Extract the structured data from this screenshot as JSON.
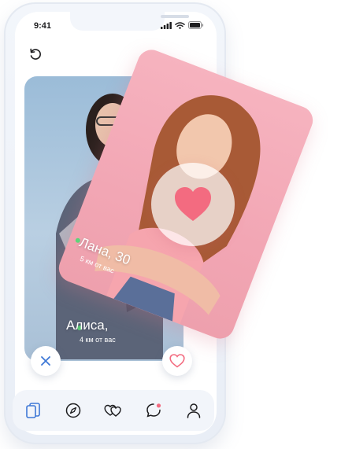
{
  "status_bar": {
    "time": "9:41"
  },
  "cards": {
    "front": {
      "name": "Лана, 30",
      "distance": "5 км от вас"
    },
    "back": {
      "name": "Алиса,",
      "distance": "4 км от вас"
    }
  },
  "colors": {
    "accent_pink": "#f36b80",
    "accent_blue": "#3e78d6",
    "online_dot": "#5fd37a",
    "card_front_bg": "#f2a6b4",
    "card_back_bg": "#a9c3db"
  },
  "icons": {
    "undo": "undo-icon",
    "like_large": "heart-filled-icon",
    "dislike": "close-icon",
    "like": "heart-outline-icon",
    "nav": [
      "cards-icon",
      "compass-icon",
      "hearts-icon",
      "chat-icon",
      "profile-icon"
    ]
  },
  "nav": {
    "active_index": 0
  }
}
